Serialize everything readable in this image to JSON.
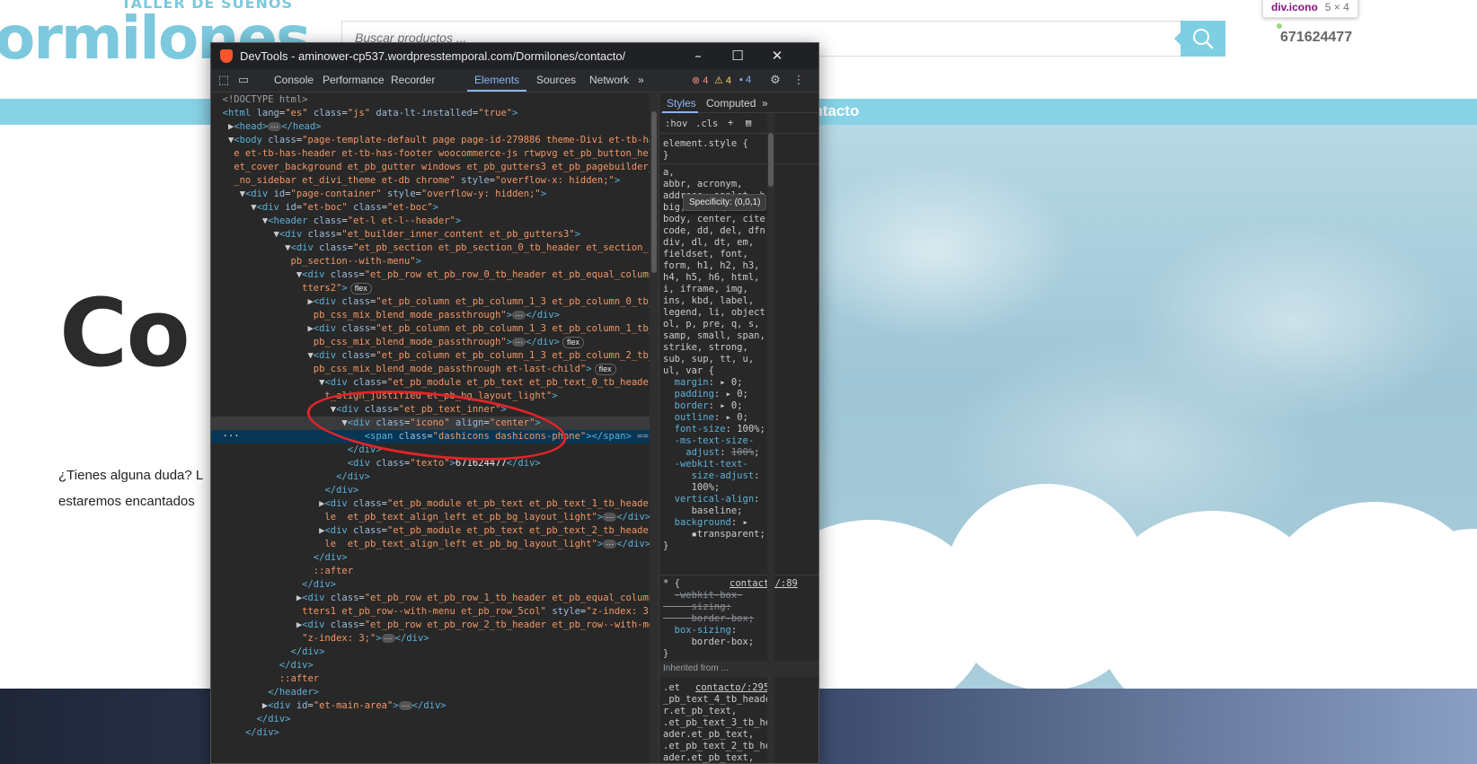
{
  "site": {
    "logo_tagline": "TALLER DE SUEÑOS",
    "logo_text": "ormilones",
    "search_placeholder": "Buscar productos ...",
    "phone": "671624477",
    "nav_item": "ontacto",
    "hero_title": "Co",
    "hero_text_1": "¿Tienes alguna duda? L",
    "hero_text_2": "estaremos encantados",
    "inspect_tooltip": {
      "tag": "div.icono",
      "size": "5 × 4"
    }
  },
  "devtools": {
    "window_title": "DevTools - aminower-cp537.wordpresstemporal.com/Dormilones/contacto/",
    "tabs": [
      "Console",
      "Performance",
      "Recorder",
      "Elements",
      "Sources",
      "Network",
      "»"
    ],
    "active_tab": "Elements",
    "counts": {
      "errors": "4",
      "warnings": "4",
      "messages": "4"
    },
    "styles_tabs": [
      "Styles",
      "Computed",
      "»"
    ],
    "filter_tokens": [
      ":hov",
      ".cls"
    ],
    "specificity_tooltip": "Specificity: (0,0,1)",
    "element_style": "element.style {",
    "inherited_label": "Inherited from ...",
    "links": [
      "contacto/:89",
      "contacto/:89",
      "contacto/:295"
    ]
  },
  "icons": {
    "search": "search-icon",
    "inspect": "inspect-element-icon",
    "device": "device-toolbar-icon",
    "settings": "gear-icon",
    "more": "more-vertical-icon"
  },
  "colors": {
    "brand_blue": "#7cc9de",
    "devtools_bg": "#282828",
    "selected_row": "#073655",
    "annotation_red": "#e0242a"
  }
}
